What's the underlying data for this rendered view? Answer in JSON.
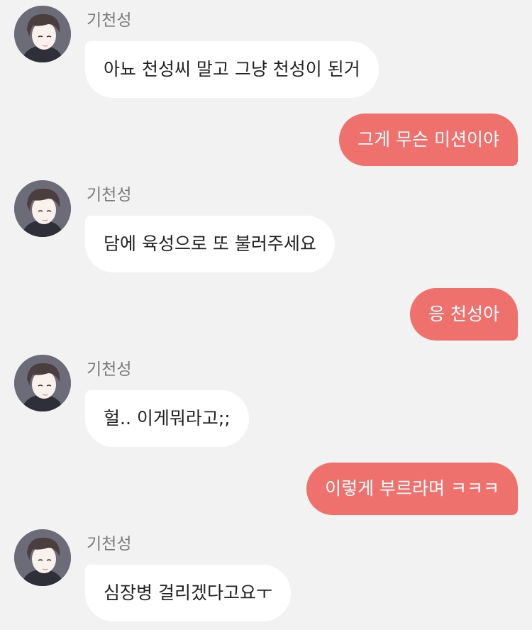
{
  "chat": {
    "messages": [
      {
        "direction": "in",
        "sender": "기천성",
        "text": "아뇨 천성씨 말고 그냥 천성이 된거"
      },
      {
        "direction": "out",
        "text": "그게 무슨 미션이야"
      },
      {
        "direction": "in",
        "sender": "기천성",
        "text": "담에 육성으로 또 불러주세요"
      },
      {
        "direction": "out",
        "text": "응 천성아"
      },
      {
        "direction": "in",
        "sender": "기천성",
        "text": "헐.. 이게뭐라고;;"
      },
      {
        "direction": "out",
        "text": "이렇게 부르라며 ㅋㅋㅋ"
      },
      {
        "direction": "in",
        "sender": "기천성",
        "text": "심장병 걸리겠다고요ㅜ"
      }
    ]
  },
  "colors": {
    "background": "#f2f2f2",
    "incoming_bubble": "#ffffff",
    "outgoing_bubble": "#ee716e",
    "sender_name": "#7a7a7a"
  },
  "icons": {
    "avatar": "avatar-icon"
  }
}
